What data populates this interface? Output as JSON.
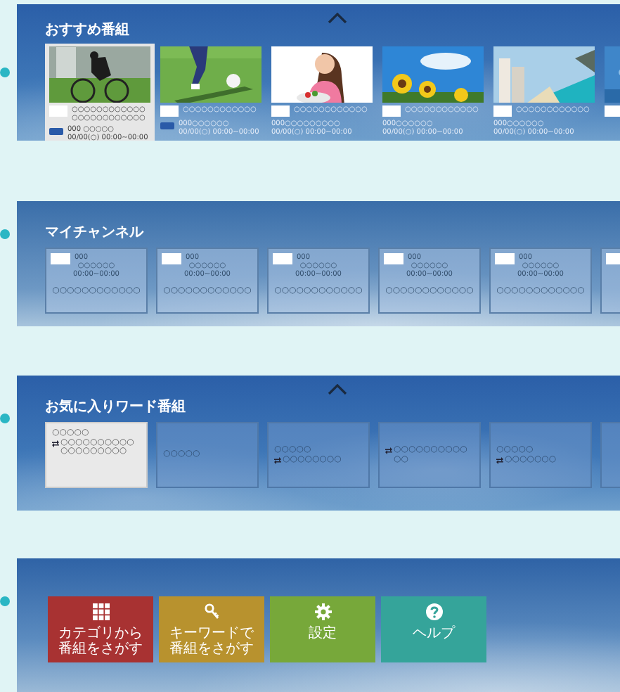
{
  "sections": [
    {
      "kind": "programs",
      "title": "おすすめ番組",
      "collapse_arrow": true,
      "cards": [
        {
          "selected": true,
          "badge": true,
          "name": "○○○○○○○○○○○○○○○○○○○○○○○○",
          "channel": "000 ○○○○○",
          "time": "00/00(○) 00:00~00:00"
        },
        {
          "selected": false,
          "badge": true,
          "name": "○○○○○○○○○○○○",
          "channel": "000○○○○○○",
          "time": "00/00(○) 00:00~00:00"
        },
        {
          "selected": false,
          "name": "○○○○○○○○○○○○",
          "channel": "000○○○○○○○○○",
          "time": "00/00(○) 00:00~00:00"
        },
        {
          "selected": false,
          "name": "○○○○○○○○○○○○",
          "channel": "000○○○○○○",
          "time": "00/00(○) 00:00~00:00"
        },
        {
          "selected": false,
          "name": "○○○○○○○○○○○○",
          "channel": "000○○○○○○",
          "time": "00/00(○) 00:00~00:00"
        },
        {
          "selected": false
        }
      ]
    },
    {
      "kind": "channels",
      "title": "マイチャンネル",
      "cards": [
        {
          "kind": "full",
          "number": "000",
          "name": "○○○○○○",
          "time": "00:00~00:00",
          "program": "○○○○○○○○○○○○"
        },
        {
          "kind": "full",
          "number": "000",
          "name": "○○○○○○",
          "time": "00:00~00:00",
          "program": "○○○○○○○○○○○○"
        },
        {
          "kind": "full",
          "number": "000",
          "name": "○○○○○○",
          "time": "00:00~00:00",
          "program": "○○○○○○○○○○○○"
        },
        {
          "kind": "full",
          "number": "000",
          "name": "○○○○○○",
          "time": "00:00~00:00",
          "program": "○○○○○○○○○○○○"
        },
        {
          "kind": "full",
          "number": "000",
          "name": "○○○○○○",
          "time": "00:00~00:00",
          "program": "○○○○○○○○○○○○"
        },
        {
          "kind": "partial"
        }
      ]
    },
    {
      "kind": "words",
      "title": "お気に入りワード番組",
      "collapse_arrow": true,
      "cards": [
        {
          "selected": true,
          "word": "○○○○○",
          "programs": "○○○○○○○○○○○○○○○○○○○"
        },
        {
          "selected": false,
          "word": "○○○○○"
        },
        {
          "selected": false,
          "word": "○○○○○",
          "programs": "○○○○○○○○"
        },
        {
          "selected": false,
          "programs": "○○○○○○○○○○○○"
        },
        {
          "selected": false,
          "word": "○○○○○",
          "programs": "○○○○○○○"
        },
        {
          "selected": false
        }
      ]
    },
    {
      "kind": "menu",
      "buttons": [
        {
          "kind": "category",
          "label": "カテゴリから番組をさがす",
          "color": "#a83232"
        },
        {
          "kind": "keyword",
          "label": "キーワードで番組をさがす",
          "color": "#b8922e"
        },
        {
          "kind": "settings",
          "label": "設定",
          "color": "#77a83a"
        },
        {
          "kind": "help",
          "label": "ヘルプ",
          "color": "#35a49a"
        }
      ]
    }
  ]
}
